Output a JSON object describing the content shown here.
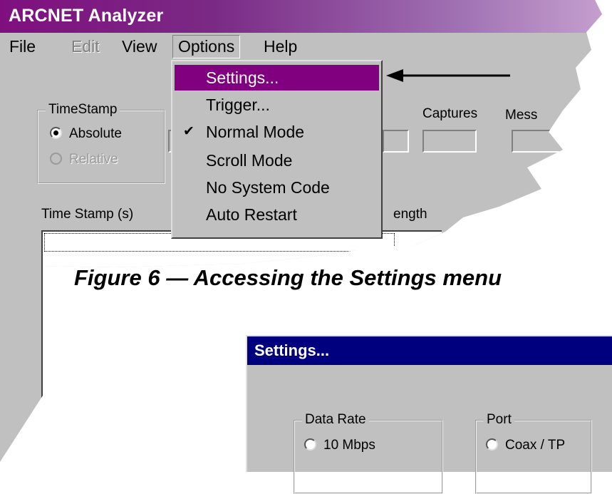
{
  "window": {
    "title": "ARCNET Analyzer"
  },
  "menubar": {
    "items": [
      {
        "label": "File"
      },
      {
        "label": "Edit"
      },
      {
        "label": "View"
      },
      {
        "label": "Options"
      },
      {
        "label": "Help"
      }
    ]
  },
  "timestamp_group": {
    "legend": "TimeStamp",
    "options": [
      {
        "label": "Absolute",
        "selected": true,
        "enabled": true
      },
      {
        "label": "Relative",
        "selected": false,
        "enabled": false
      }
    ]
  },
  "counters": {
    "captures_label": "Captures",
    "messages_label": "Mess"
  },
  "list": {
    "col_timestamp": "Time Stamp (s)",
    "col_length": "ength"
  },
  "options_menu": {
    "items": [
      {
        "label": "Settings...",
        "highlighted": true,
        "checked": false
      },
      {
        "label": "Trigger...",
        "highlighted": false,
        "checked": false
      },
      {
        "label": "Normal Mode",
        "highlighted": false,
        "checked": true
      },
      {
        "label": "Scroll Mode",
        "highlighted": false,
        "checked": false
      },
      {
        "label": "No System Code",
        "highlighted": false,
        "checked": false
      },
      {
        "label": "Auto Restart",
        "highlighted": false,
        "checked": false
      }
    ]
  },
  "caption": "Figure 6 — Accessing the Settings menu",
  "settings_dialog": {
    "title": "Settings...",
    "data_rate": {
      "legend": "Data Rate",
      "option": "10 Mbps"
    },
    "port": {
      "legend": "Port",
      "option": "Coax / TP"
    }
  },
  "colors": {
    "titlebar": "#7f0f7f",
    "menu_highlight": "#800080",
    "dialog_titlebar": "#00007f",
    "window_face": "#c0c0c0"
  }
}
